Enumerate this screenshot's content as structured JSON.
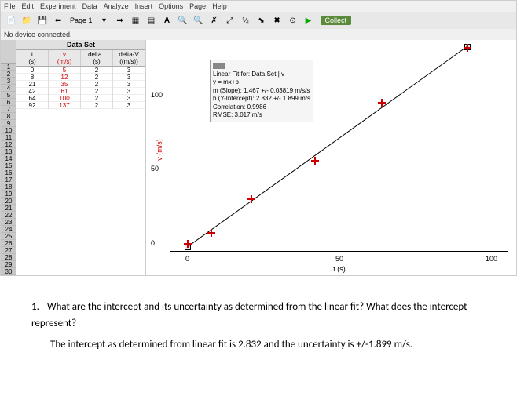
{
  "menu": [
    "File",
    "Edit",
    "Experiment",
    "Data",
    "Analyze",
    "Insert",
    "Options",
    "Page",
    "Help"
  ],
  "page_label": "Page 1",
  "collect_label": "Collect",
  "status": "No device connected.",
  "dataset_title": "Data Set",
  "columns": [
    {
      "name": "t",
      "unit": "(s)"
    },
    {
      "name": "v",
      "unit": "(m/s)"
    },
    {
      "name": "delta t",
      "unit": "(s)"
    },
    {
      "name": "delta-V",
      "unit": "((m/s))"
    }
  ],
  "rows": [
    {
      "t": "0",
      "v": "5",
      "dt": "2",
      "dv": "3"
    },
    {
      "t": "8",
      "v": "12",
      "dt": "2",
      "dv": "3"
    },
    {
      "t": "21",
      "v": "35",
      "dt": "2",
      "dv": "3"
    },
    {
      "t": "42",
      "v": "61",
      "dt": "2",
      "dv": "3"
    },
    {
      "t": "64",
      "v": "100",
      "dt": "2",
      "dv": "3"
    },
    {
      "t": "92",
      "v": "137",
      "dt": "2",
      "dv": "3"
    }
  ],
  "row_count": 30,
  "chart": {
    "y_label": "v (m/s)",
    "x_label": "t (s)",
    "y_ticks": [
      {
        "v": 0,
        "p": 0
      },
      {
        "v": 50,
        "p": 36.5
      },
      {
        "v": 100,
        "p": 73
      }
    ],
    "x_ticks": [
      {
        "v": 0,
        "p": 5
      },
      {
        "v": 50,
        "p": 50
      },
      {
        "v": 100,
        "p": 95
      }
    ]
  },
  "fit_box": {
    "title": "Linear Fit for: Data Set | v",
    "eq": "y = mx+b",
    "slope": "m (Slope): 1.467 +/- 0.03819 m/s/s",
    "intercept": "b (Y-Intercept): 2.832 +/- 1.899 m/s",
    "corr": "Correlation: 0.9986",
    "rmse": "RMSE: 3.017 m/s"
  },
  "chart_data": {
    "type": "scatter",
    "title": "",
    "xlabel": "t (s)",
    "ylabel": "v (m/s)",
    "xlim": [
      0,
      100
    ],
    "ylim": [
      0,
      137
    ],
    "series": [
      {
        "name": "v",
        "x": [
          0,
          8,
          21,
          42,
          64,
          92
        ],
        "y": [
          5,
          12,
          35,
          61,
          100,
          137
        ]
      }
    ],
    "fit": {
      "type": "linear",
      "slope": 1.467,
      "slope_err": 0.03819,
      "intercept": 2.832,
      "intercept_err": 1.899,
      "correlation": 0.9986,
      "rmse": 3.017
    }
  },
  "question": {
    "num": "1.",
    "q": "What are the intercept and its uncertainty as determined from the linear fit? What does the intercept represent?",
    "a": "The intercept as determined from linear fit is 2.832 and the uncertainty is +/-1.899 m/s."
  }
}
